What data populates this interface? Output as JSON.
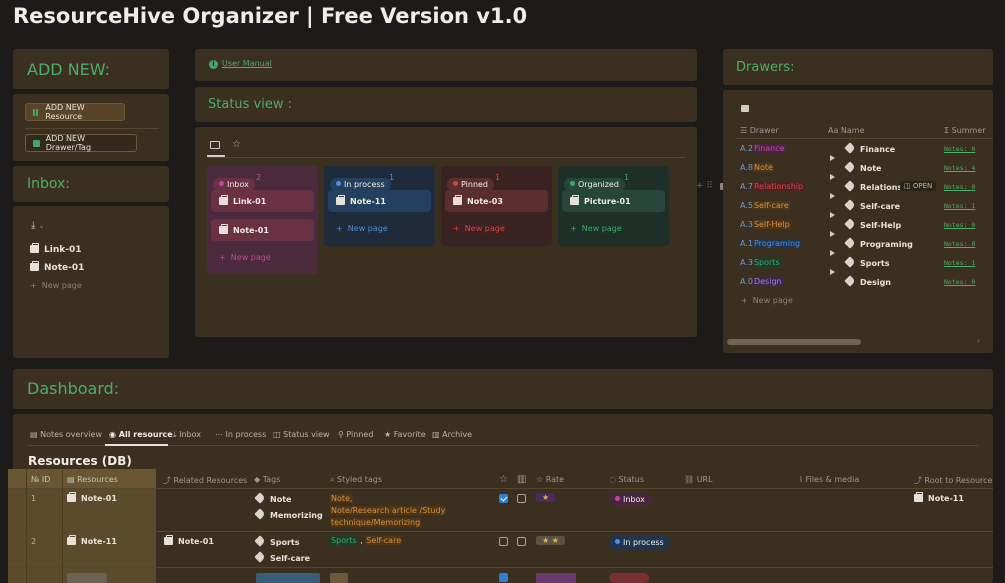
{
  "app": {
    "title": "ResourceHive Organizer | Free Version v1.0"
  },
  "add_new": {
    "title": "ADD NEW:",
    "resource_btn": "ADD NEW Resource",
    "drawer_btn": "ADD NEW Drawer/Tag"
  },
  "inbox": {
    "title": "Inbox:",
    "items": [
      "Link-01",
      "Note-01"
    ],
    "new_page": "New page"
  },
  "manual": {
    "label": "User Manual"
  },
  "status_view": {
    "title": "Status view :",
    "columns": [
      {
        "name": "Inbox",
        "count": "2",
        "color": "#c2489c",
        "bg": "#4a2a3c",
        "card_bg": "#6a3145",
        "cards": [
          "Link-01",
          "Note-01"
        ]
      },
      {
        "name": "In process",
        "count": "1",
        "color": "#2f72c7",
        "bg": "#1f2a3a",
        "card_bg": "#23405e",
        "cards": [
          "Note-11"
        ]
      },
      {
        "name": "Pinned",
        "count": "1",
        "color": "#c04a4a",
        "bg": "#3b2222",
        "card_bg": "#5a2e2d",
        "cards": [
          "Note-03"
        ]
      },
      {
        "name": "Organized",
        "count": "1",
        "color": "#3b9e5f",
        "bg": "#1e2f27",
        "card_bg": "#27463a",
        "cards": [
          "Picture-01"
        ]
      }
    ],
    "new_page": "New page"
  },
  "drawers": {
    "title": "Drawers:",
    "col_drawer": "Drawer",
    "col_name": "Name",
    "col_summary": "Summer",
    "rows": [
      {
        "prefix": "A.2",
        "tag": "Finance",
        "tag_color": "#c2489c",
        "tag_bg": "#4a2540",
        "name": "Finance",
        "notes": "Notes: 0",
        "arrow": true
      },
      {
        "prefix": "A.8",
        "tag": "Note",
        "tag_color": "#d9913a",
        "tag_bg": "#4c3518",
        "name": "Note",
        "notes": "Notes: 4",
        "arrow": true
      },
      {
        "prefix": "A.7",
        "tag": "Relationship",
        "tag_color": "#d64545",
        "tag_bg": "#4f2222",
        "name": "Relationshi",
        "notes": "Notes: 0",
        "arrow": true,
        "open": "OPEN"
      },
      {
        "prefix": "A.5",
        "tag": "Self-care",
        "tag_color": "#d9913a",
        "tag_bg": "#4c3518",
        "name": "Self-care",
        "notes": "Notes: 1",
        "arrow": true
      },
      {
        "prefix": "A.3",
        "tag": "Self-Help",
        "tag_color": "#d9913a",
        "tag_bg": "#4c3518",
        "name": "Self-Help",
        "notes": "Notes: 0",
        "arrow": true
      },
      {
        "prefix": "A.1",
        "tag": "Programing",
        "tag_color": "#4a8fd9",
        "tag_bg": "#1f3550",
        "name": "Programing",
        "notes": "Notes: 0",
        "arrow": true
      },
      {
        "prefix": "A.3",
        "tag": "Sports",
        "tag_color": "#3ea86a",
        "tag_bg": "#1f3b2b",
        "name": "Sports",
        "notes": "Notes: 1",
        "arrow": true
      },
      {
        "prefix": "A.0",
        "tag": "Design",
        "tag_color": "#a878d8",
        "tag_bg": "#3a2850",
        "name": "Design",
        "notes": "Notes: 0",
        "arrow": false
      }
    ],
    "new_page": "New page"
  },
  "dashboard": {
    "title": "Dashboard:",
    "tabs": [
      "Notes overview",
      "All resource",
      "Inbox",
      "In process",
      "Status view",
      "Pinned",
      "Favorite",
      "Archive"
    ],
    "active_tab": "All resource",
    "db_title": "Resources (DB)",
    "columns": [
      "ID",
      "Resources",
      "Related Resources",
      "Tags",
      "Styled tags",
      "Rate",
      "Status",
      "URL",
      "Files & media",
      "Root to Resource"
    ],
    "rows": [
      {
        "id": "1",
        "resource": "Note-01",
        "related": "",
        "tags": [
          "Note",
          "Memorizing"
        ],
        "styled_line1": "Note,",
        "styled_line2": "Note/Research article /Study",
        "styled_line3": "technique/Memorizing",
        "fav": true,
        "trash": false,
        "rate": "★",
        "status": "Inbox",
        "status_color": "#c2489c",
        "status_bg": "#4a2540",
        "root": "Note-11"
      },
      {
        "id": "2",
        "resource": "Note-11",
        "related": "Note-01",
        "tags": [
          "Sports",
          "Self-care"
        ],
        "styled_a": "Sports",
        "styled_b": "Self-care",
        "fav": false,
        "trash": false,
        "rate": "★ ★",
        "status": "In process",
        "status_color": "#2f72c7",
        "status_bg": "#1f3550",
        "root": ""
      }
    ]
  },
  "colors": {
    "accent": "#4cae6b",
    "panel": "#3b2f1f",
    "bg": "#1c1b19"
  }
}
